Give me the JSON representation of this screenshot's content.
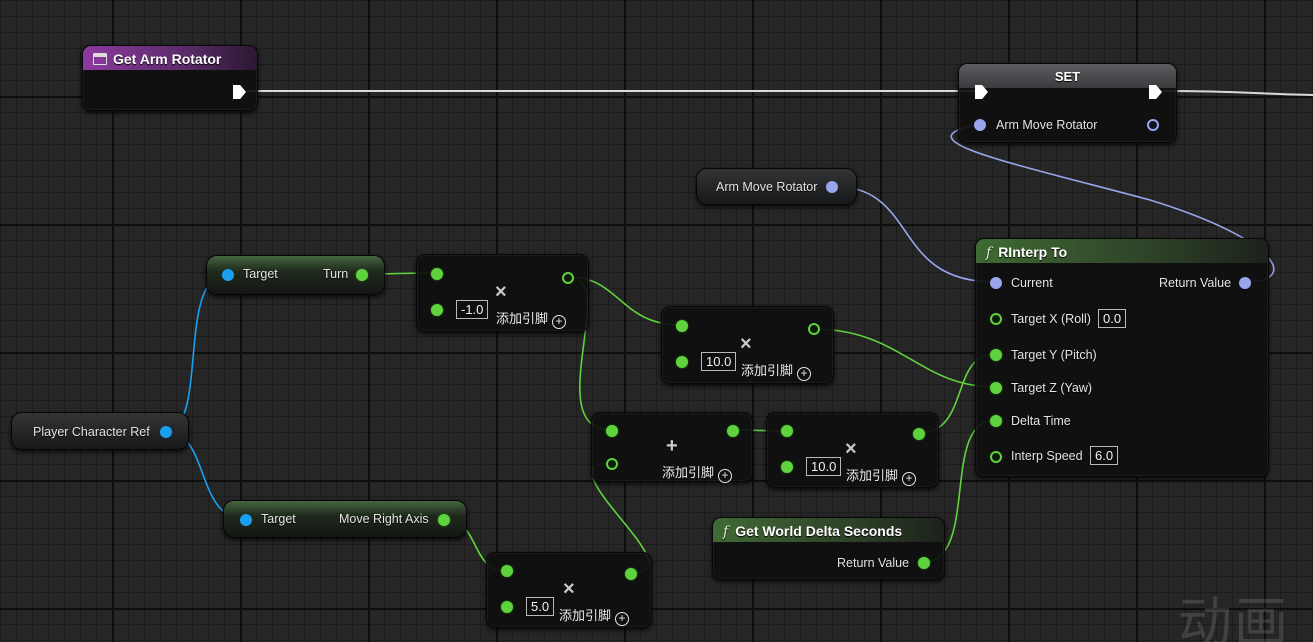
{
  "nodes": {
    "get_arm_rotator": {
      "title": "Get Arm Rotator"
    },
    "set": {
      "title": "SET",
      "pin_label": "Arm Move Rotator"
    },
    "arm_move_rotator_var": {
      "label": "Arm Move Rotator"
    },
    "rinterp": {
      "title": "RInterp To",
      "current": "Current",
      "return_value": "Return Value",
      "target_x": "Target X (Roll)",
      "target_x_value": "0.0",
      "target_y": "Target Y (Pitch)",
      "target_z": "Target Z (Yaw)",
      "delta_time": "Delta Time",
      "interp_speed": "Interp Speed",
      "interp_speed_value": "6.0"
    },
    "turn_getter": {
      "target": "Target",
      "output": "Turn"
    },
    "move_right_getter": {
      "target": "Target",
      "output": "Move Right Axis"
    },
    "player_ref": {
      "label": "Player Character Ref"
    },
    "multiply_1": {
      "value": "-1.0",
      "add_pin": "添加引脚"
    },
    "multiply_2": {
      "value": "10.0",
      "add_pin": "添加引脚"
    },
    "add_node": {
      "add_pin": "添加引脚"
    },
    "multiply_3": {
      "value": "10.0",
      "add_pin": "添加引脚"
    },
    "multiply_4": {
      "value": "5.0",
      "add_pin": "添加引脚"
    },
    "get_world_delta": {
      "title": "Get World Delta Seconds",
      "return_value": "Return Value"
    }
  },
  "symbols": {
    "multiply": "×",
    "add": "+",
    "plus_circle": "+",
    "function": "f"
  },
  "watermark": "动画",
  "colors": {
    "float_pin": "#5fd33d",
    "object_pin": "#1a9ff0",
    "rotator_pin": "#9aa6ec",
    "exec_pin": "#ffffff",
    "function_header": "#3f6a33",
    "event_header": "#8c3aa0"
  }
}
